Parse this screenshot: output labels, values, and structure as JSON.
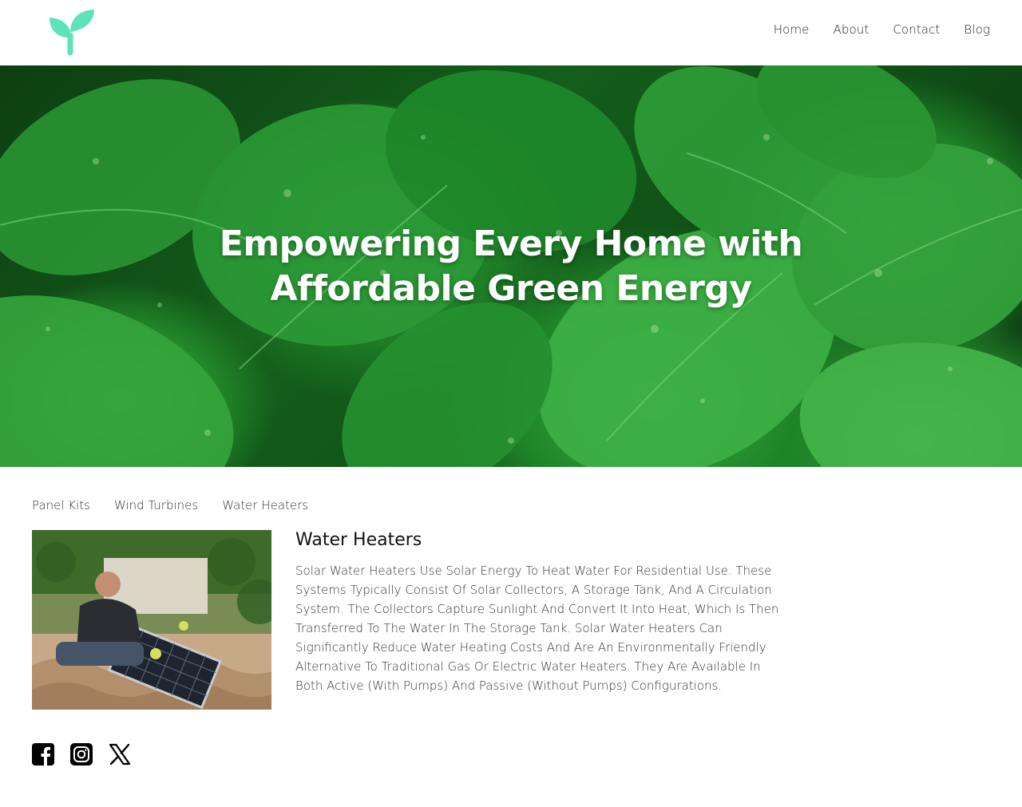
{
  "brand": {
    "logo_icon": "sprout-icon",
    "accent_color": "#5ee3b8"
  },
  "nav": {
    "items": [
      {
        "label": "Home"
      },
      {
        "label": "About"
      },
      {
        "label": "Contact"
      },
      {
        "label": "Blog"
      }
    ]
  },
  "hero": {
    "title_line1": "Empowering Every Home with",
    "title_line2": "Affordable Green Energy",
    "background": "green-leaves-with-water-droplets"
  },
  "tabs": {
    "items": [
      {
        "label": "Panel Kits"
      },
      {
        "label": "Wind Turbines"
      },
      {
        "label": "Water Heaters"
      }
    ]
  },
  "product": {
    "title": "Water Heaters",
    "description": "Solar Water Heaters Use Solar Energy To Heat Water For Residential Use. These Systems Typically Consist Of Solar Collectors, A Storage Tank, And A Circulation System. The Collectors Capture Sunlight And Convert It Into Heat, Which Is Then Transferred To The Water In The Storage Tank. Solar Water Heaters Can Significantly Reduce Water Heating Costs And Are An Environmentally Friendly Alternative To Traditional Gas Or Electric Water Heaters. They Are Available In Both Active (With Pumps) And Passive (Without Pumps) Configurations.",
    "image": "man-installing-solar-panel-on-roof"
  },
  "social": {
    "icons": [
      "facebook-icon",
      "instagram-icon",
      "x-icon"
    ]
  }
}
